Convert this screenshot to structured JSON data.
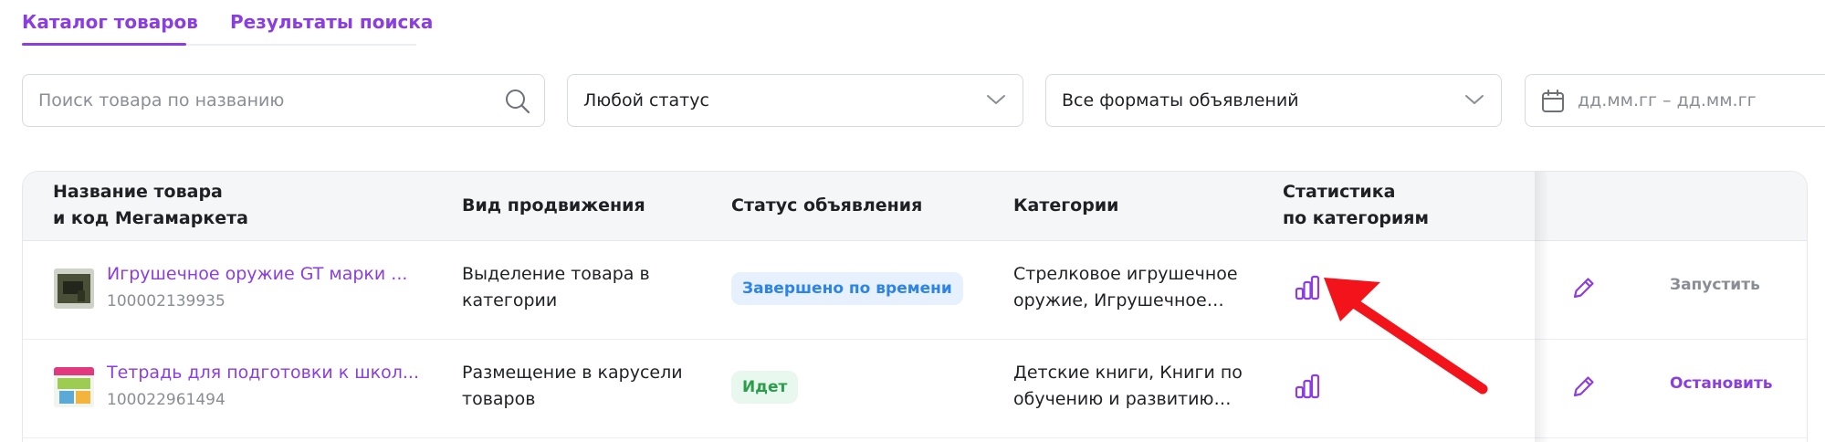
{
  "tabs": [
    {
      "label": "Каталог товаров",
      "active": true
    },
    {
      "label": "Результаты поиска",
      "active": false
    }
  ],
  "filters": {
    "search_placeholder": "Поиск товара по названию",
    "status_value": "Любой статус",
    "format_value": "Все форматы объявлений",
    "date_placeholder": "дд.мм.гг – дд.мм.гг"
  },
  "table": {
    "headers": {
      "name_line1": "Название товара",
      "name_line2": "и код Мегамаркета",
      "promo": "Вид продвижения",
      "status": "Статус объявления",
      "categories": "Категории",
      "stats_line1": "Статистика",
      "stats_line2": "по категориям"
    },
    "rows": [
      {
        "name": "Игрушечное оружие GT марки ...",
        "code": "100002139935",
        "promo": "Выделение товара в категории",
        "status": "Завершено по времени",
        "categories": "Стрелковое игрушечное оружие, Игрушечное…",
        "action": "Запустить"
      },
      {
        "name": "Тетрадь для подготовки к школ...",
        "code": "100022961494",
        "promo": "Размещение в карусели товаров",
        "status": "Идет",
        "categories": "Детские книги, Книги по обучению и развитию…",
        "action": "Остановить"
      }
    ]
  },
  "colors": {
    "accent": "#8b3ee0",
    "status_done": "#2d83e6",
    "status_running": "#2a9e4c",
    "annotation_arrow": "#f2131b"
  },
  "icons": [
    "search-icon",
    "chevron-down-icon",
    "calendar-icon",
    "bar-chart-icon",
    "pencil-icon"
  ]
}
